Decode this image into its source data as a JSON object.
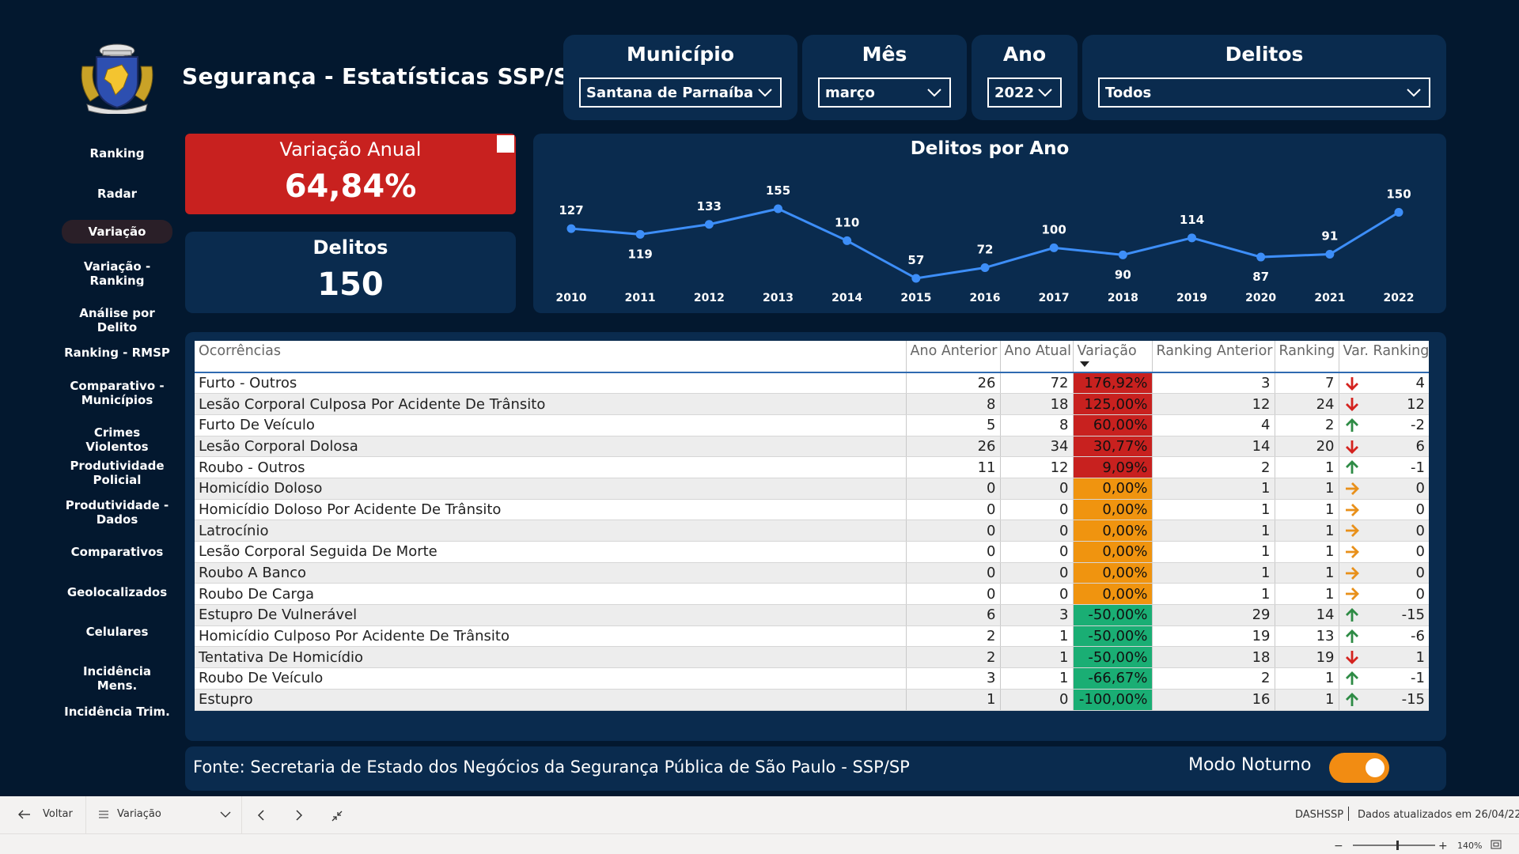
{
  "header": {
    "title": "Segurança - Estatísticas SSP/SP"
  },
  "filters": {
    "municipio": {
      "label": "Município",
      "value": "Santana de Parnaíba"
    },
    "mes": {
      "label": "Mês",
      "value": "março"
    },
    "ano": {
      "label": "Ano",
      "value": "2022"
    },
    "delitos": {
      "label": "Delitos",
      "value": "Todos"
    }
  },
  "sidebar": {
    "items": [
      {
        "label": "Ranking"
      },
      {
        "label": "Radar"
      },
      {
        "label": "Variação"
      },
      {
        "label": "Variação - Ranking"
      },
      {
        "label": "Análise por Delito"
      },
      {
        "label": "Ranking - RMSP"
      },
      {
        "label": "Comparativo - Municípios"
      },
      {
        "label": "Crimes Violentos"
      },
      {
        "label": "Produtividade Policial"
      },
      {
        "label": "Produtividade - Dados"
      },
      {
        "label": "Comparativos"
      },
      {
        "label": "Geolocalizados"
      },
      {
        "label": "Celulares"
      },
      {
        "label": "Incidência Mens."
      },
      {
        "label": "Incidência Trim."
      }
    ]
  },
  "cards": {
    "variacao": {
      "label": "Variação Anual",
      "value": "64,84%"
    },
    "delitos": {
      "label": "Delitos",
      "value": "150"
    }
  },
  "chart_data": {
    "type": "line",
    "title": "Delitos por Ano",
    "x": [
      "2010",
      "2011",
      "2012",
      "2013",
      "2014",
      "2015",
      "2016",
      "2017",
      "2018",
      "2019",
      "2020",
      "2021",
      "2022"
    ],
    "series": [
      {
        "values": [
          127,
          119,
          133,
          155,
          110,
          57,
          72,
          100,
          90,
          114,
          87,
          91,
          150
        ]
      }
    ],
    "label_positions": [
      "above",
      "below",
      "above",
      "above",
      "above",
      "above",
      "above",
      "above",
      "below",
      "above",
      "below",
      "above",
      "above"
    ],
    "color": "#3d8ef8",
    "grid": false,
    "legend": "none"
  },
  "table": {
    "columns": [
      "Ocorrências",
      "Ano Anterior",
      "Ano Atual",
      "Variação",
      "Ranking Anterior",
      "Ranking",
      "Var. Ranking"
    ],
    "rows": [
      {
        "ocorrencia": "Furto - Outros",
        "ano_anterior": "26",
        "ano_atual": "72",
        "variacao": "176,92%",
        "ranking_anterior": "3",
        "ranking": "7",
        "trend": "down",
        "var_ranking": "4",
        "status": "red"
      },
      {
        "ocorrencia": "Lesão Corporal Culposa Por Acidente De Trânsito",
        "ano_anterior": "8",
        "ano_atual": "18",
        "variacao": "125,00%",
        "ranking_anterior": "12",
        "ranking": "24",
        "trend": "down",
        "var_ranking": "12",
        "status": "red"
      },
      {
        "ocorrencia": "Furto De Veículo",
        "ano_anterior": "5",
        "ano_atual": "8",
        "variacao": "60,00%",
        "ranking_anterior": "4",
        "ranking": "2",
        "trend": "up",
        "var_ranking": "-2",
        "status": "red"
      },
      {
        "ocorrencia": "Lesão Corporal Dolosa",
        "ano_anterior": "26",
        "ano_atual": "34",
        "variacao": "30,77%",
        "ranking_anterior": "14",
        "ranking": "20",
        "trend": "down",
        "var_ranking": "6",
        "status": "red"
      },
      {
        "ocorrencia": "Roubo - Outros",
        "ano_anterior": "11",
        "ano_atual": "12",
        "variacao": "9,09%",
        "ranking_anterior": "2",
        "ranking": "1",
        "trend": "up",
        "var_ranking": "-1",
        "status": "red"
      },
      {
        "ocorrencia": "Homicídio Doloso",
        "ano_anterior": "0",
        "ano_atual": "0",
        "variacao": "0,00%",
        "ranking_anterior": "1",
        "ranking": "1",
        "trend": "flat",
        "var_ranking": "0",
        "status": "orange"
      },
      {
        "ocorrencia": "Homicídio Doloso Por Acidente De Trânsito",
        "ano_anterior": "0",
        "ano_atual": "0",
        "variacao": "0,00%",
        "ranking_anterior": "1",
        "ranking": "1",
        "trend": "flat",
        "var_ranking": "0",
        "status": "orange"
      },
      {
        "ocorrencia": "Latrocínio",
        "ano_anterior": "0",
        "ano_atual": "0",
        "variacao": "0,00%",
        "ranking_anterior": "1",
        "ranking": "1",
        "trend": "flat",
        "var_ranking": "0",
        "status": "orange"
      },
      {
        "ocorrencia": "Lesão Corporal Seguida De Morte",
        "ano_anterior": "0",
        "ano_atual": "0",
        "variacao": "0,00%",
        "ranking_anterior": "1",
        "ranking": "1",
        "trend": "flat",
        "var_ranking": "0",
        "status": "orange"
      },
      {
        "ocorrencia": "Roubo A Banco",
        "ano_anterior": "0",
        "ano_atual": "0",
        "variacao": "0,00%",
        "ranking_anterior": "1",
        "ranking": "1",
        "trend": "flat",
        "var_ranking": "0",
        "status": "orange"
      },
      {
        "ocorrencia": "Roubo De Carga",
        "ano_anterior": "0",
        "ano_atual": "0",
        "variacao": "0,00%",
        "ranking_anterior": "1",
        "ranking": "1",
        "trend": "flat",
        "var_ranking": "0",
        "status": "orange"
      },
      {
        "ocorrencia": "Estupro De Vulnerável",
        "ano_anterior": "6",
        "ano_atual": "3",
        "variacao": "-50,00%",
        "ranking_anterior": "29",
        "ranking": "14",
        "trend": "up",
        "var_ranking": "-15",
        "status": "green"
      },
      {
        "ocorrencia": "Homicídio Culposo Por Acidente De Trânsito",
        "ano_anterior": "2",
        "ano_atual": "1",
        "variacao": "-50,00%",
        "ranking_anterior": "19",
        "ranking": "13",
        "trend": "up",
        "var_ranking": "-6",
        "status": "green"
      },
      {
        "ocorrencia": "Tentativa De Homicídio",
        "ano_anterior": "2",
        "ano_atual": "1",
        "variacao": "-50,00%",
        "ranking_anterior": "18",
        "ranking": "19",
        "trend": "down",
        "var_ranking": "1",
        "status": "green"
      },
      {
        "ocorrencia": "Roubo De Veículo",
        "ano_anterior": "3",
        "ano_atual": "1",
        "variacao": "-66,67%",
        "ranking_anterior": "2",
        "ranking": "1",
        "trend": "up",
        "var_ranking": "-1",
        "status": "green"
      },
      {
        "ocorrencia": "Estupro",
        "ano_anterior": "1",
        "ano_atual": "0",
        "variacao": "-100,00%",
        "ranking_anterior": "16",
        "ranking": "1",
        "trend": "up",
        "var_ranking": "-15",
        "status": "green"
      }
    ]
  },
  "colors": {
    "red": "#c8211f",
    "orange": "#f0940f",
    "green": "#1aae74",
    "arrow_red": "#d4231f",
    "arrow_green": "#2e8b45",
    "arrow_orange": "#e8901a"
  },
  "footer": {
    "source": "Fonte: Secretaria de Estado dos Negócios da Segurança Pública de São Paulo - SSP/SP",
    "night_mode_label": "Modo Noturno",
    "night_mode_on": true
  },
  "bottombar": {
    "back_label": "Voltar",
    "page_label": "Variação",
    "workspace": "DASHSSP",
    "updated": "Dados atualizados em 26/04/22",
    "zoom": "140%"
  }
}
